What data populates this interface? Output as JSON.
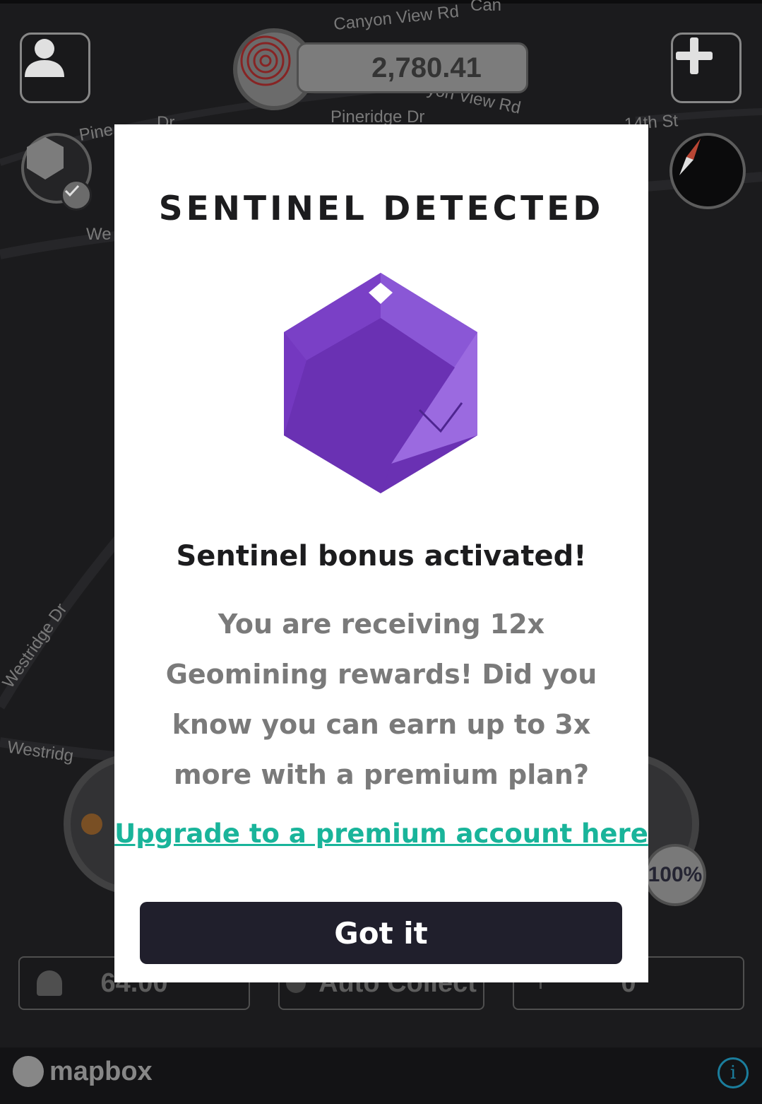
{
  "map": {
    "streets": {
      "canyon_view_top": "Canyon View Rd",
      "canyon_top_cut": "Can",
      "canyon_view_mid": "yon View Rd",
      "pineridge": "Pineridge Dr",
      "pine_left": "Pine",
      "pine_left_dr": "Dr",
      "fourteenth": "14th St",
      "we": "We",
      "westridge_dr_diag": "Westridge Dr",
      "westridge_bottom": "Westridg"
    },
    "attribution": "mapbox"
  },
  "hud": {
    "balance": "2,780.41",
    "battery_percent": "100%",
    "stats": {
      "drops_value": "64.00",
      "auto_collect_label": "Auto Collect",
      "flags_value": "0"
    }
  },
  "modal": {
    "title": "SENTINEL DETECTED",
    "subtitle": "Sentinel bonus activated!",
    "body": "You are receiving 12x Geomining rewards! Did you know you can earn up to 3x more with a premium plan?",
    "link": "Upgrade to a premium account here",
    "button": "Got it"
  },
  "colors": {
    "modal_button": "#201f2c",
    "link": "#19b49a",
    "gem": "#7a3fc2"
  }
}
